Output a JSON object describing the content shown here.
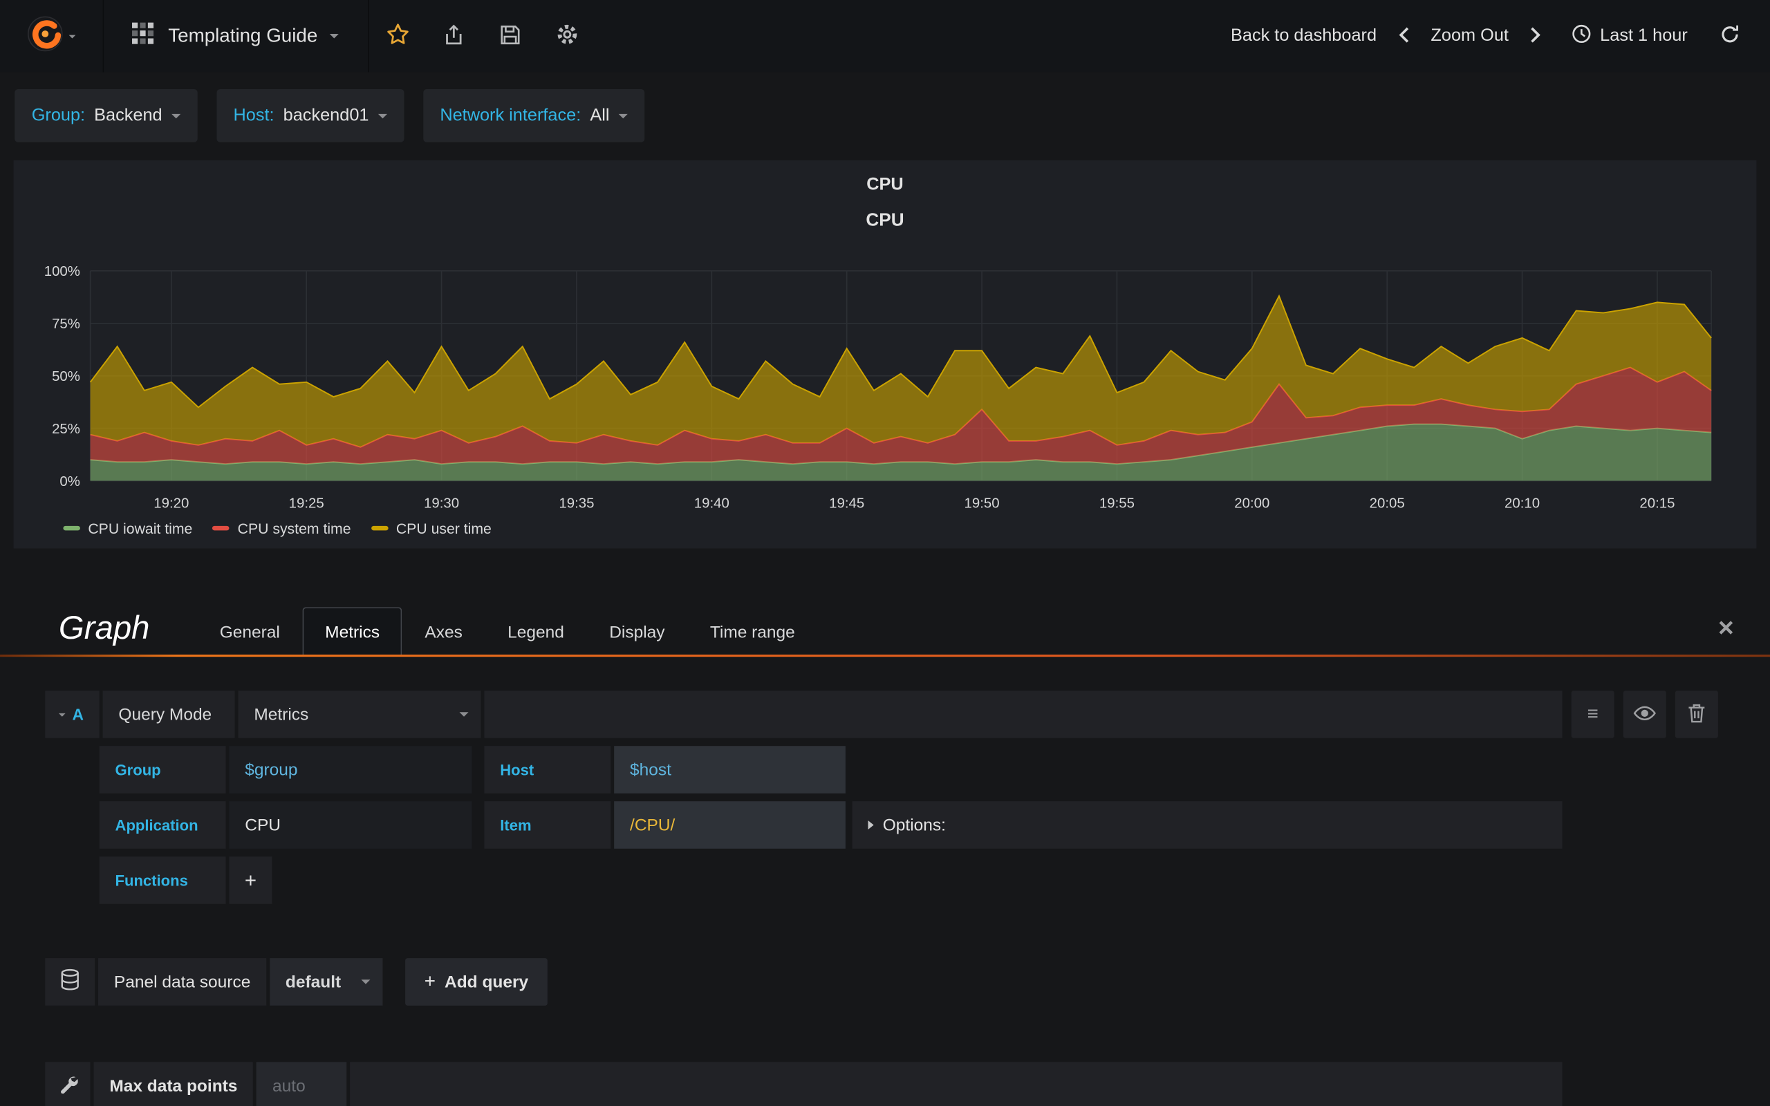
{
  "nav": {
    "brand": "Grafana",
    "dashboard_title": "Templating Guide",
    "back_label": "Back to dashboard",
    "zoom_out_label": "Zoom Out",
    "time_range_label": "Last 1 hour"
  },
  "variables": [
    {
      "label": "Group:",
      "value": "Backend"
    },
    {
      "label": "Host:",
      "value": "backend01"
    },
    {
      "label": "Network interface:",
      "value": "All"
    }
  ],
  "panel": {
    "title": "CPU",
    "graph_title": "CPU"
  },
  "chart_data": {
    "type": "area",
    "stacked": true,
    "title": "CPU",
    "ylim": [
      0,
      100
    ],
    "y_tick_values": [
      0,
      25,
      50,
      75,
      100
    ],
    "y_tick_labels": [
      "0%",
      "25%",
      "50%",
      "75%",
      "100%"
    ],
    "x_range_minutes": 60,
    "x_tick_minutes": [
      3,
      8,
      13,
      18,
      23,
      28,
      33,
      38,
      43,
      48,
      53,
      58
    ],
    "x_tick_labels": [
      "19:20",
      "19:25",
      "19:30",
      "19:35",
      "19:40",
      "19:45",
      "19:50",
      "19:55",
      "20:00",
      "20:05",
      "20:10",
      "20:15"
    ],
    "grid": true,
    "legend_position": "bottom-left",
    "series": [
      {
        "name": "CPU iowait time",
        "color": "#7eb26d",
        "values": [
          10,
          9,
          9,
          10,
          9,
          8,
          9,
          9,
          8,
          9,
          8,
          9,
          10,
          8,
          9,
          9,
          8,
          9,
          9,
          8,
          9,
          8,
          9,
          9,
          10,
          9,
          8,
          9,
          9,
          8,
          9,
          9,
          8,
          9,
          9,
          10,
          9,
          9,
          8,
          9,
          10,
          12,
          14,
          16,
          18,
          20,
          22,
          24,
          26,
          27,
          27,
          26,
          25,
          20,
          24,
          26,
          25,
          24,
          25,
          24,
          23
        ]
      },
      {
        "name": "CPU system time",
        "color": "#e24d42",
        "values": [
          12,
          10,
          14,
          9,
          8,
          12,
          10,
          15,
          9,
          11,
          8,
          13,
          10,
          16,
          9,
          12,
          18,
          10,
          9,
          14,
          10,
          9,
          15,
          11,
          9,
          13,
          10,
          9,
          16,
          10,
          12,
          9,
          14,
          25,
          10,
          9,
          12,
          15,
          9,
          10,
          14,
          10,
          9,
          12,
          28,
          10,
          9,
          11,
          10,
          9,
          12,
          10,
          9,
          13,
          10,
          20,
          25,
          30,
          22,
          28,
          20
        ]
      },
      {
        "name": "CPU user time",
        "color": "#cca300",
        "values": [
          25,
          45,
          20,
          28,
          18,
          25,
          35,
          22,
          30,
          20,
          28,
          35,
          22,
          40,
          25,
          30,
          38,
          20,
          28,
          35,
          22,
          30,
          42,
          25,
          20,
          35,
          28,
          22,
          38,
          25,
          30,
          22,
          40,
          28,
          25,
          35,
          30,
          45,
          25,
          28,
          38,
          30,
          25,
          35,
          42,
          25,
          20,
          28,
          22,
          18,
          25,
          20,
          30,
          35,
          28,
          35,
          30,
          28,
          38,
          32,
          25
        ]
      }
    ]
  },
  "editor": {
    "panel_type": "Graph",
    "tabs": [
      "General",
      "Metrics",
      "Axes",
      "Legend",
      "Display",
      "Time range"
    ],
    "active_tab": "Metrics",
    "close_label": "×",
    "query": {
      "ref": "A",
      "mode_label": "Query Mode",
      "mode_value": "Metrics",
      "group_label": "Group",
      "group_value": "$group",
      "host_label": "Host",
      "host_value": "$host",
      "application_label": "Application",
      "application_value": "CPU",
      "item_label": "Item",
      "item_value": "/CPU/",
      "options_label": "Options:",
      "functions_label": "Functions",
      "add_function_label": "+"
    },
    "datasource": {
      "label": "Panel data source",
      "value": "default",
      "add_query_label": "Add query",
      "add_query_plus": "+"
    },
    "max_data_points": {
      "label": "Max data points",
      "placeholder": "auto"
    }
  }
}
